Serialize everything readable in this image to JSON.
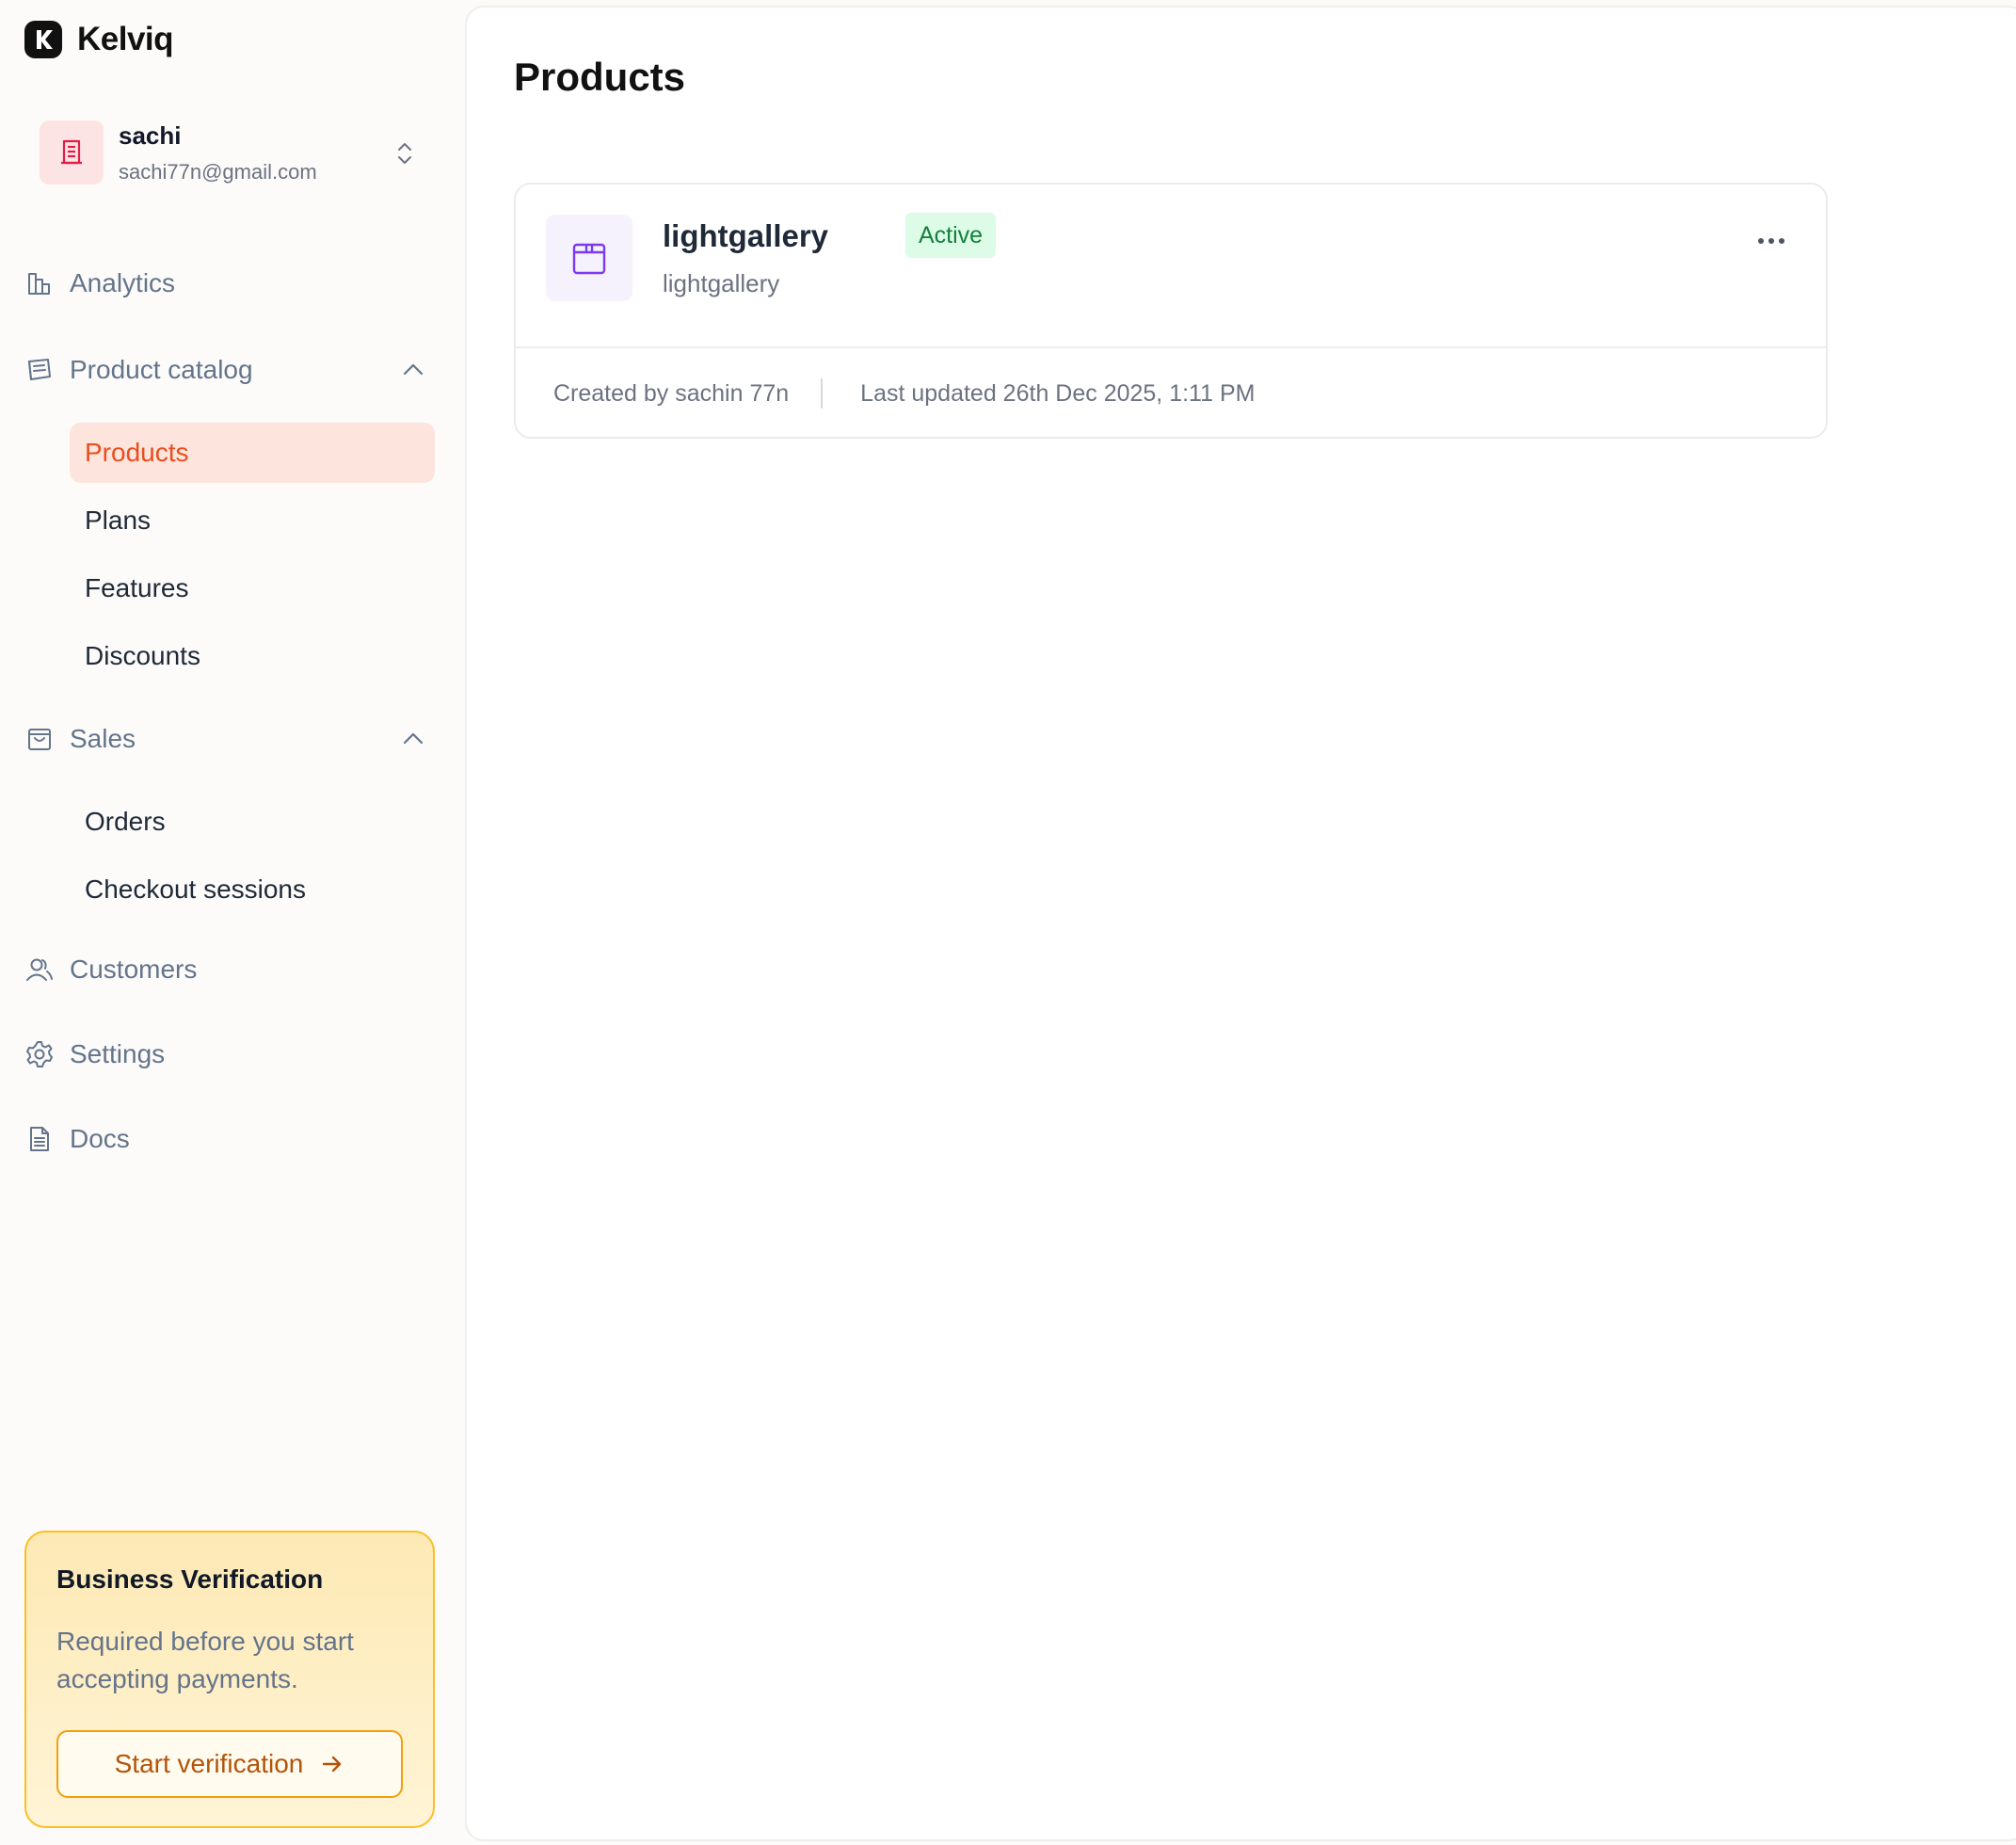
{
  "brand": {
    "name": "Kelviq"
  },
  "account": {
    "name": "sachi",
    "email": "sachi77n@gmail.com"
  },
  "nav": {
    "analytics": "Analytics",
    "product_catalog": "Product catalog",
    "catalog_items": [
      "Products",
      "Plans",
      "Features",
      "Discounts"
    ],
    "sales": "Sales",
    "sales_items": [
      "Orders",
      "Checkout sessions"
    ],
    "customers": "Customers",
    "settings": "Settings",
    "docs": "Docs"
  },
  "verification": {
    "title": "Business Verification",
    "description": "Required before you start accepting payments.",
    "button": "Start verification"
  },
  "page": {
    "title": "Products"
  },
  "product": {
    "name": "lightgallery",
    "status": "Active",
    "slug": "lightgallery",
    "created_by": "Created by sachin 77n",
    "last_updated": "Last updated 26th Dec 2025, 1:11 PM"
  },
  "colors": {
    "accent": "#ea4e1d",
    "active_bg": "#fde4dc",
    "status_active": "#15803d",
    "warning_border": "#f59e0b"
  },
  "icons": {
    "logo": "kelviq-logo-icon",
    "account": "building-icon",
    "switch": "chevron-up-down-icon",
    "analytics": "bar-chart-icon",
    "catalog": "catalog-icon",
    "sales": "shopping-bag-icon",
    "customers": "users-icon",
    "settings": "gear-icon",
    "docs": "document-icon",
    "product": "package-box-icon",
    "menu": "more-horizontal-icon",
    "arrow": "arrow-right-icon"
  }
}
